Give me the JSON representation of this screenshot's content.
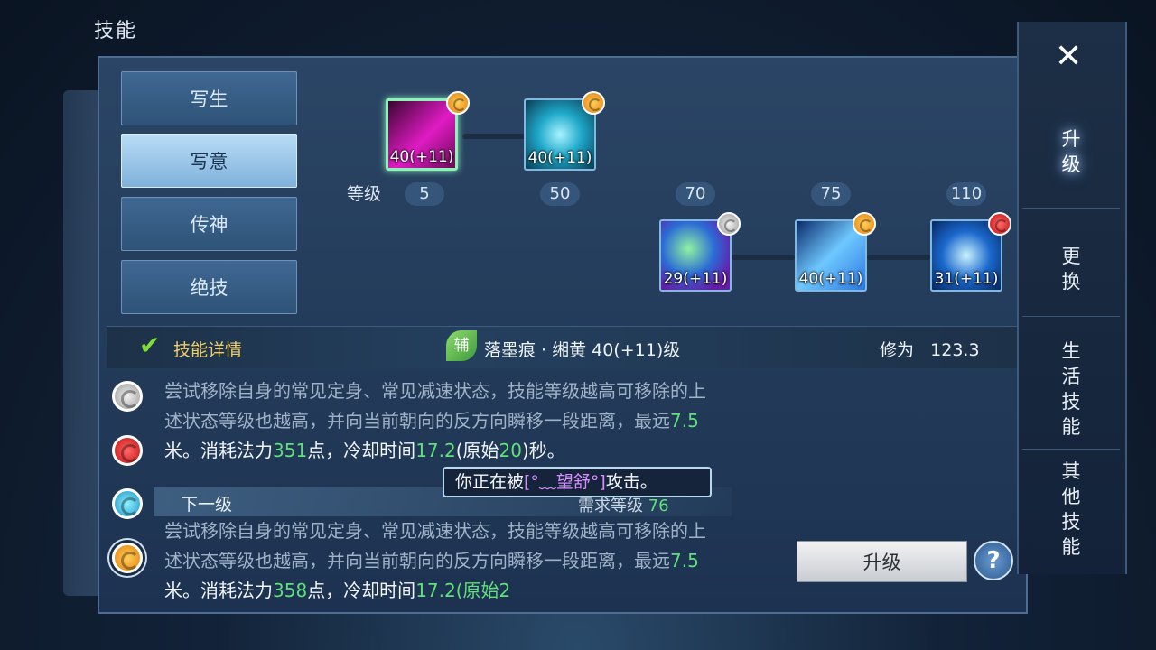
{
  "window": {
    "title": "技能"
  },
  "tabs": [
    {
      "label": "写生",
      "active": false
    },
    {
      "label": "写意",
      "active": true
    },
    {
      "label": "传神",
      "active": false
    },
    {
      "label": "绝技",
      "active": false
    }
  ],
  "skill_tree": {
    "level_label": "等级",
    "level_marks": [
      "5",
      "50",
      "70",
      "75",
      "110"
    ],
    "skills": [
      {
        "level": "40(+11)",
        "rank": "orange",
        "color": "#d21ab8",
        "selected": true
      },
      {
        "level": "40(+11)",
        "rank": "orange",
        "color": "#1fa8c9",
        "selected": false
      },
      {
        "level": "29(+11)",
        "rank": "grey",
        "color": "#2b6bd6",
        "selected": false
      },
      {
        "level": "40(+11)",
        "rank": "orange",
        "color": "#2a76e0",
        "selected": false
      },
      {
        "level": "31(+11)",
        "rank": "red",
        "color": "#1a68cc",
        "selected": false
      }
    ]
  },
  "detail": {
    "title": "技能详情",
    "aux_tag": "辅",
    "skill_name": "落墨痕 · 缃黄 40(+11)级",
    "cultivation_label": "修为",
    "cultivation_value": "123.3",
    "current_desc": {
      "t1": "尝试移除自身的常见定身、常见减速状态，技能等级越高可移除的上述状态等级也越高，并向当前朝向的反方向瞬移一段距离，最远",
      "v1": "7.5",
      "t2": "米。消耗法力",
      "v2": "351",
      "t3": "点，冷却时间",
      "v3": "17.2",
      "t4": "(原始",
      "v4": "20",
      "t5": ")秒。"
    },
    "next_label": "下一级",
    "need_level_label": "需求等级",
    "need_level_value": "76",
    "next_desc": {
      "t1": "尝试移除自身的常见定身、常见减速状态，技能等级越高可移除的上述状态等级也越高，并向当前朝向的反方向瞬移一段距离，最远",
      "v1": "7.5",
      "t2": "米。消耗法力",
      "v2": "358",
      "t3": "点，冷却时间",
      "v3": "17.2",
      "t4": "(原始2"
    },
    "rank_icons": [
      "grey",
      "red",
      "cyan",
      "orange"
    ]
  },
  "tooltip": {
    "prefix": "你正在被",
    "attacker": "[°﹏望舒°]",
    "suffix": "攻击。"
  },
  "buttons": {
    "upgrade": "升级",
    "help": "?"
  },
  "right_rail": {
    "items": [
      "升级",
      "更换",
      "生活技能",
      "其他技能"
    ]
  }
}
